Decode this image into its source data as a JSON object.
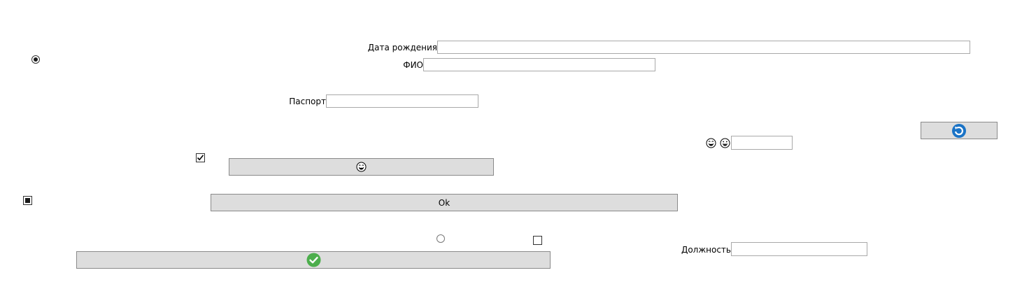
{
  "form": {
    "birth_date": {
      "label": "Дата рождения",
      "value": ""
    },
    "full_name": {
      "label": "ФИО",
      "value": ""
    },
    "passport": {
      "label": "Паспорт",
      "value": ""
    },
    "position": {
      "label": "Должность",
      "value": ""
    },
    "emoji_input": {
      "value": ""
    }
  },
  "buttons": {
    "ok_label": "Ok",
    "emoji_button_icon": "laughing-emoji-icon",
    "top_right_button_icon": "blue-circle-arrow-icon",
    "confirm_button_icon": "green-check-icon"
  },
  "controls": {
    "radio_top": {
      "checked": true
    },
    "radio_bottom": {
      "checked": false
    },
    "checkbox_checked": {
      "checked": true
    },
    "checkbox_indeterminate": {
      "state": "indeterminate"
    },
    "checkbox_empty": {
      "checked": false
    }
  },
  "icons": {
    "emoji_left": "laughing-emoji-icon",
    "emoji_right": "grinning-emoji-icon"
  },
  "colors": {
    "button_bg": "#dddddd",
    "input_border": "#a9a9a9",
    "accent_blue": "#1a73c6",
    "accent_green": "#4cae4c"
  }
}
